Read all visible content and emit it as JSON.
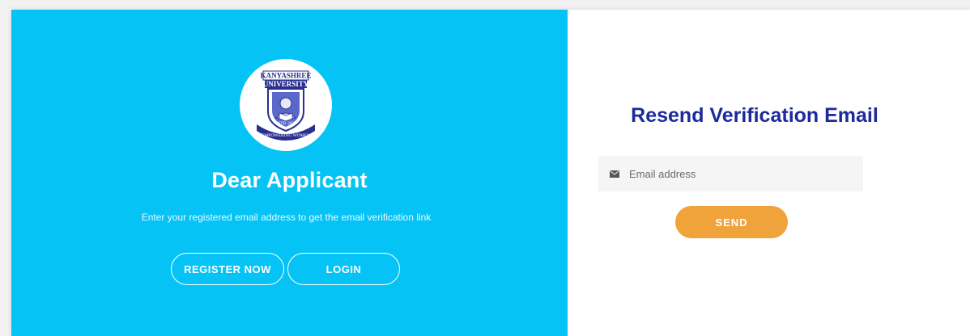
{
  "left_panel": {
    "logo": {
      "top_text": "KANYASHREE",
      "middle_text": "UNIVERSITY",
      "est_text": "ESTD. 2020",
      "banner_text": "EMPOWERING WOMEN"
    },
    "title": "Dear Applicant",
    "subtitle": "Enter your registered email address to get the email verification link",
    "register_label": "REGISTER NOW",
    "login_label": "LOGIN"
  },
  "right_panel": {
    "title": "Resend Verification Email",
    "email_placeholder": "Email address",
    "email_value": "",
    "send_label": "SEND"
  },
  "colors": {
    "left_bg": "#05c3f5",
    "title_blue": "#1c2a9c",
    "send_orange": "#f0a33b"
  },
  "icons": {
    "email": "envelope-icon",
    "logo": "university-crest-icon"
  }
}
